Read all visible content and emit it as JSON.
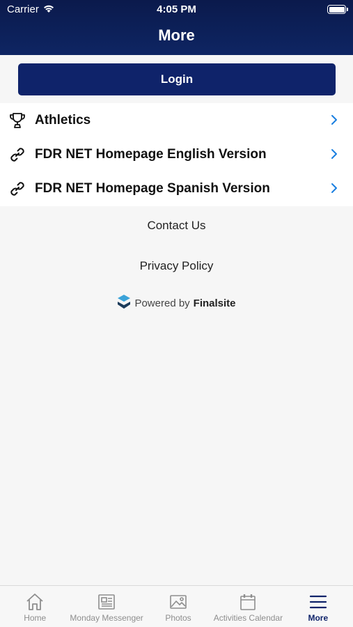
{
  "status_bar": {
    "carrier": "Carrier",
    "time": "4:05 PM"
  },
  "header": {
    "title": "More"
  },
  "login": {
    "label": "Login"
  },
  "menu": {
    "items": [
      {
        "label": "Athletics",
        "icon": "trophy-icon"
      },
      {
        "label": "FDR NET Homepage English Version",
        "icon": "link-icon"
      },
      {
        "label": "FDR NET Homepage Spanish Version",
        "icon": "link-icon"
      }
    ]
  },
  "footer": {
    "contact": "Contact Us",
    "privacy": "Privacy Policy",
    "powered_prefix": "Powered by",
    "powered_brand": "Finalsite"
  },
  "tabs": [
    {
      "label": "Home",
      "icon": "home-icon"
    },
    {
      "label": "Monday Messenger",
      "icon": "newspaper-icon"
    },
    {
      "label": "Photos",
      "icon": "photo-icon"
    },
    {
      "label": "Activities Calendar",
      "icon": "calendar-icon"
    },
    {
      "label": "More",
      "icon": "menu-icon",
      "active": true
    }
  ],
  "colors": {
    "header": "#0e2563",
    "accent": "#0f236a",
    "chevron": "#1a7fe0",
    "background": "#f6f6f6"
  }
}
